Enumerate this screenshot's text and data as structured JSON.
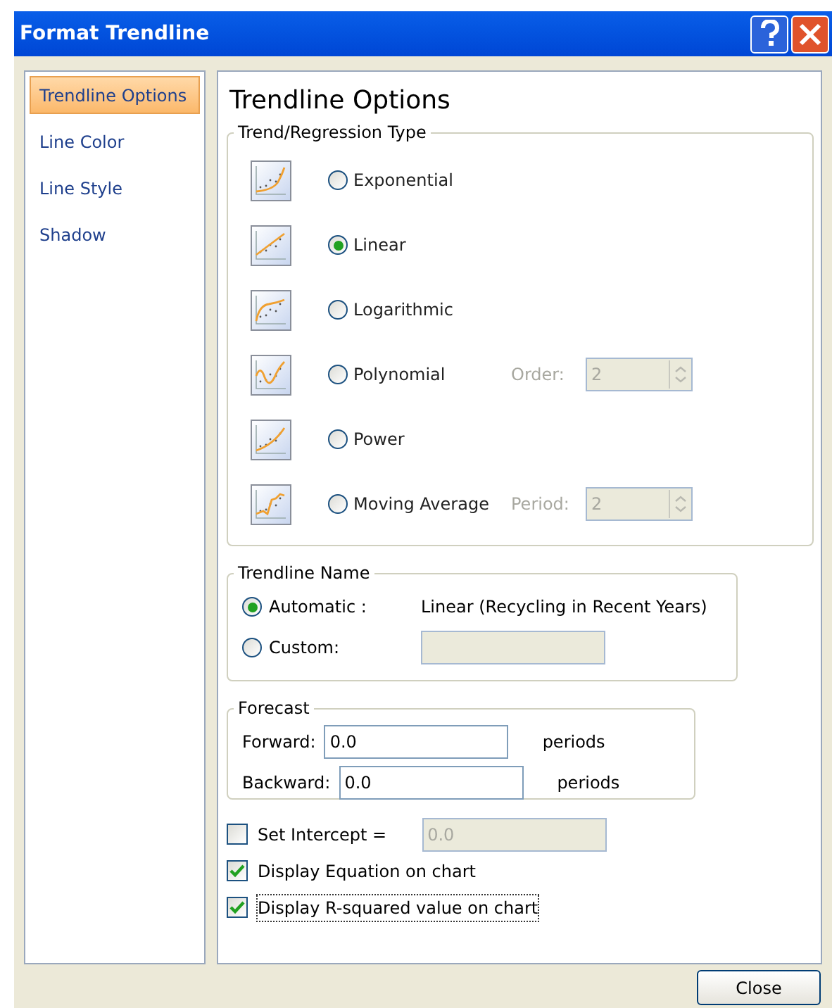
{
  "window": {
    "title": "Format Trendline"
  },
  "sidebar": {
    "items": [
      {
        "label": "Trendline Options",
        "selected": true
      },
      {
        "label": "Line Color",
        "selected": false
      },
      {
        "label": "Line Style",
        "selected": false
      },
      {
        "label": "Shadow",
        "selected": false
      }
    ]
  },
  "panel_title": "Trendline Options",
  "regression": {
    "title": "Trend/Regression Type",
    "options": [
      {
        "kind": "exponential",
        "label": "Exponential",
        "selected": false
      },
      {
        "kind": "linear",
        "label": "Linear",
        "selected": true
      },
      {
        "kind": "logarithmic",
        "label": "Logarithmic",
        "selected": false
      },
      {
        "kind": "polynomial",
        "label": "Polynomial",
        "selected": false,
        "field_label": "Order:",
        "field_value": "2",
        "disabled": true
      },
      {
        "kind": "power",
        "label": "Power",
        "selected": false
      },
      {
        "kind": "moving_average",
        "label": "Moving Average",
        "selected": false,
        "field_label": "Period:",
        "field_value": "2",
        "disabled": true
      }
    ]
  },
  "trendline_name": {
    "title": "Trendline Name",
    "automatic": {
      "label": "Automatic :",
      "selected": true,
      "value": "Linear (Recycling in Recent Years)"
    },
    "custom": {
      "label": "Custom:",
      "selected": false,
      "disabled": true
    }
  },
  "forecast": {
    "title": "Forecast",
    "fields": [
      {
        "label": "Forward:",
        "value": "0.0",
        "unit": "periods"
      },
      {
        "label": "Backward:",
        "value": "0.0",
        "unit": "periods"
      }
    ]
  },
  "checks": [
    {
      "label": "Set Intercept =",
      "checked": false,
      "value": "0.0",
      "disabled": true
    },
    {
      "label": "Display Equation on chart",
      "checked": true
    },
    {
      "label": "Display R-squared value on chart",
      "checked": true,
      "focused": true
    }
  ],
  "buttons": [
    "Close"
  ]
}
